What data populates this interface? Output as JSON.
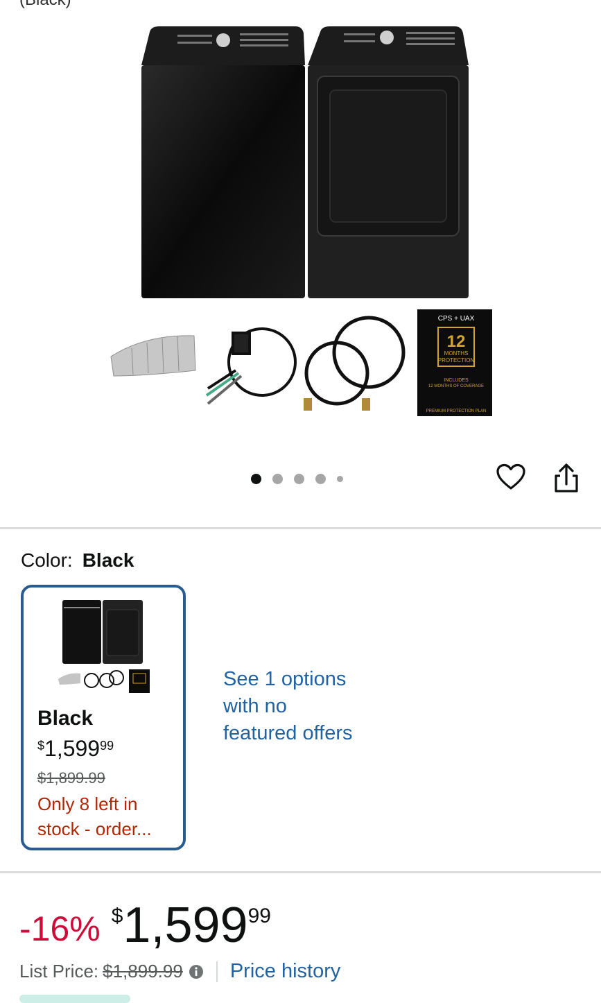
{
  "product": {
    "title_cut": "(Black)",
    "image_alt": "Samsung black top-load washer and electric dryer set with dryer vent duct, power cord, water hoses and protection plan",
    "accessories": [
      "dryer-vent-duct",
      "dryer-power-cord",
      "washer-water-hoses",
      "protection-plan-box"
    ],
    "plan_box": {
      "brand": "CPS + UAX",
      "number": "12",
      "line1": "MONTHS",
      "line2": "PROTECTION",
      "includes": "INCLUDES",
      "coverage": "12 MONTHS OF COVERAGE",
      "footer": "PREMIUM PROTECTION PLAN"
    }
  },
  "carousel": {
    "total": 5,
    "active_index": 0
  },
  "actions": {
    "favorite_icon": "heart-icon",
    "share_icon": "share-icon"
  },
  "color": {
    "label": "Color:",
    "selected": "Black",
    "swatch": {
      "name": "Black",
      "currency": "$",
      "price_whole": "1,599",
      "price_fraction": "99",
      "list_price": "$1,899.99",
      "stock_message": "Only 8 left in stock - order..."
    },
    "see_options": "See 1 options with no featured offers"
  },
  "pricing": {
    "discount": "-16%",
    "currency": "$",
    "price_whole": "1,599",
    "price_fraction": "99",
    "list_price_label": "List Price:",
    "list_price": "$1,899.99",
    "price_history_link": "Price history"
  },
  "colors": {
    "accent_link": "#2162a1",
    "deal_red": "#cc0c39",
    "stock_red": "#b12704",
    "selected_border": "#2a5b8f"
  }
}
